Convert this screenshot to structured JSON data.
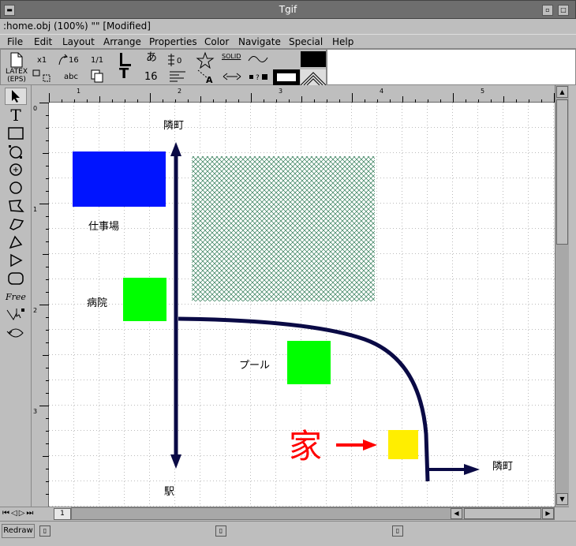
{
  "window": {
    "title": "Tgif"
  },
  "status_line": ":home.obj (100%) \"\" [Modified]",
  "menu": [
    "File",
    "Edit",
    "Layout",
    "Arrange",
    "Properties",
    "Color",
    "Navigate",
    "Special",
    "Help"
  ],
  "choice_panel": {
    "row1": [
      "x1",
      "16",
      "1/1",
      "あ",
      "0",
      "SOLID"
    ],
    "row2_latex": "LATEX",
    "row2_eps": "(EPS)",
    "row2_text": "abc",
    "row2_num": "16"
  },
  "rulers": {
    "h_ticks": [
      "1",
      "2",
      "3",
      "4",
      "5"
    ],
    "v_ticks": [
      "0",
      "1",
      "2",
      "3"
    ]
  },
  "canvas": {
    "labels": {
      "top_neighbor": "隣町",
      "workplace": "仕事場",
      "hospital": "病院",
      "pool": "プール",
      "home": "家",
      "station": "駅",
      "right_neighbor": "隣町"
    },
    "colors": {
      "blue": "#0014ff",
      "green": "#00ff00",
      "yellow": "#ffee00",
      "navy": "#0a0a45",
      "red": "#ff0000"
    }
  },
  "page_tab": "1",
  "bottom": {
    "redraw": "Redraw"
  }
}
